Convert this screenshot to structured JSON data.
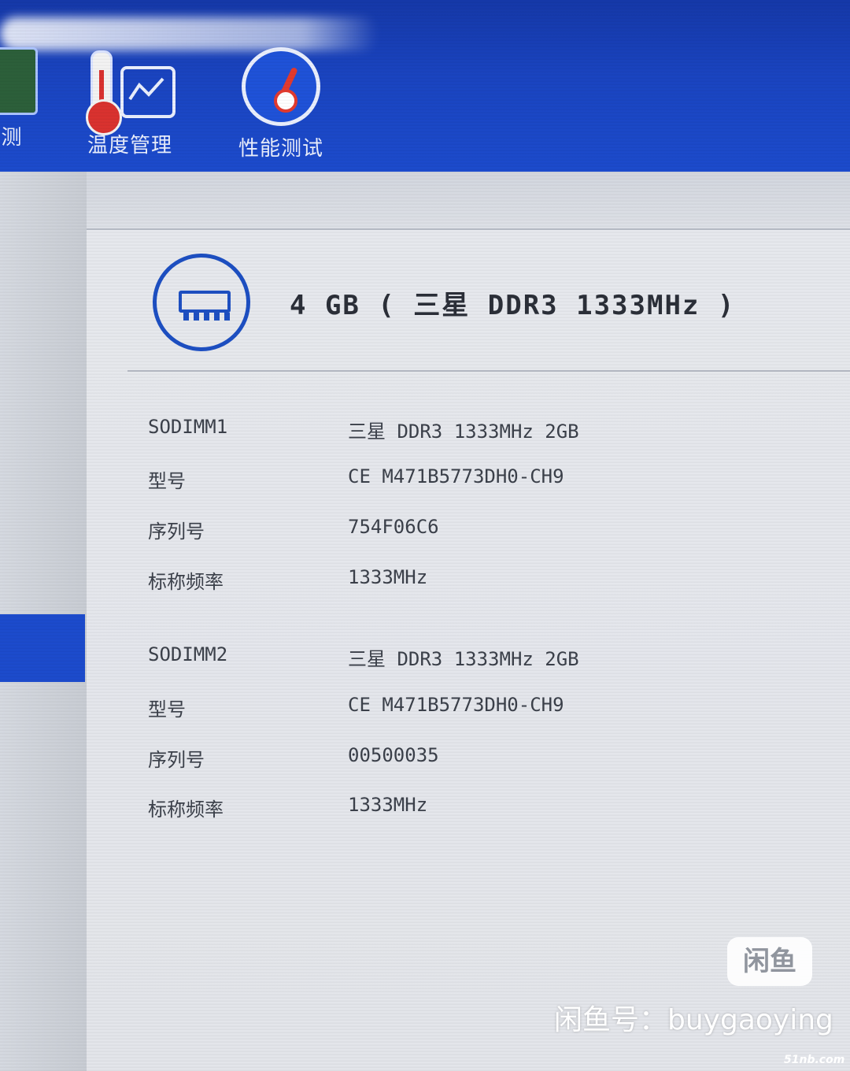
{
  "toolbar": {
    "tools": [
      {
        "label": "测",
        "icon": "memory-chip-icon"
      },
      {
        "label": "温度管理",
        "icon": "thermometer-graph-icon"
      },
      {
        "label": "性能测试",
        "icon": "speedometer-icon"
      }
    ]
  },
  "memory": {
    "icon": "memory-module-icon",
    "summary": "4 GB ( 三星 DDR3 1333MHz )",
    "slots": [
      {
        "slot": "SODIMM1",
        "slot_value": "三星 DDR3 1333MHz 2GB",
        "model_label": "型号",
        "model": "CE M471B5773DH0-CH9",
        "serial_label": "序列号",
        "serial": "754F06C6",
        "freq_label": "标称频率",
        "freq": "1333MHz"
      },
      {
        "slot": "SODIMM2",
        "slot_value": "三星 DDR3 1333MHz 2GB",
        "model_label": "型号",
        "model": "CE M471B5773DH0-CH9",
        "serial_label": "序列号",
        "serial": "00500035",
        "freq_label": "标称频率",
        "freq": "1333MHz"
      }
    ]
  },
  "watermark": {
    "badge": "闲鱼",
    "text": "闲鱼号：buygaoying",
    "site": "51nb.com"
  },
  "colors": {
    "toolbar_blue": "#1c4bcc",
    "accent_blue": "#1d4fc2",
    "panel_bg": "#e3e5ea"
  }
}
